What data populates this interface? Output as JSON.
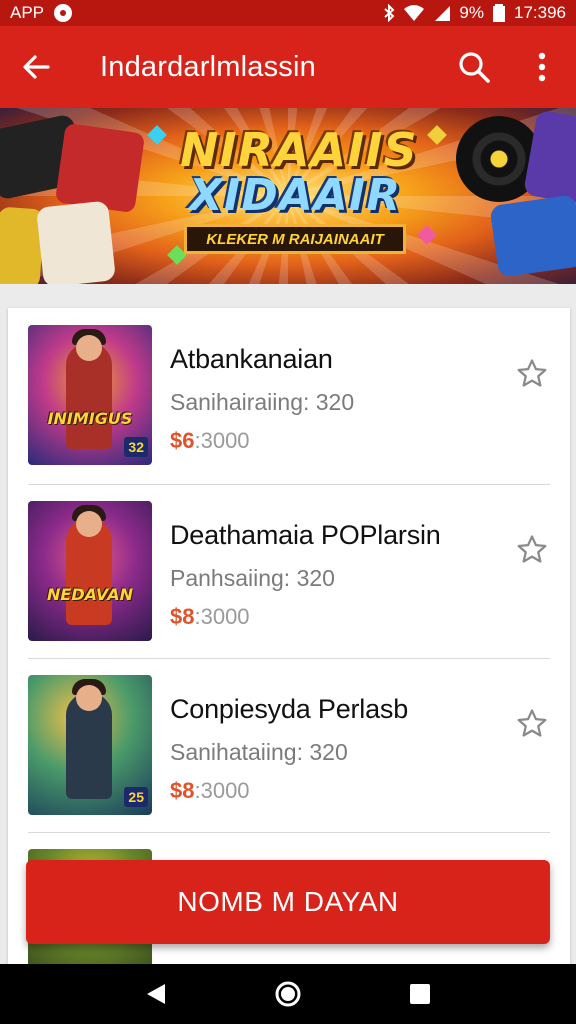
{
  "status_bar": {
    "app_label": "APP",
    "battery": "9%",
    "time": "17:396"
  },
  "app_bar": {
    "title": "Indardarlmlassin",
    "back_icon": "arrow-left-icon",
    "search_icon": "search-icon",
    "menu_icon": "more-vert-icon"
  },
  "banner": {
    "logo_line1": "NIRAAIIS",
    "logo_line2": "XIDAAIR",
    "ribbon": "KLEKER M RAIJAINAAIT"
  },
  "items": [
    {
      "name": "Atbankanaian",
      "subtitle": "Sanihairaiing: 320",
      "price_currency": "$6",
      "price_rest": ":3000",
      "thumb_label": "INIMIGUS",
      "thumb_num": "32",
      "favorite": false
    },
    {
      "name": "Deathamaia POPlarsin",
      "subtitle": "Panhsaiing: 320",
      "price_currency": "$8",
      "price_rest": ":3000",
      "thumb_label": "NEDAVAN",
      "thumb_num": "",
      "favorite": false
    },
    {
      "name": "Conpiesyda Perlasb",
      "subtitle": "Sanihataiing: 320",
      "price_currency": "$8",
      "price_rest": ":3000",
      "thumb_label": "",
      "thumb_num": "25",
      "favorite": false
    }
  ],
  "cta_button": {
    "label": "NOMB M DAYAN"
  },
  "nav_bar": {
    "back_icon": "triangle-back-icon",
    "home_icon": "circle-home-icon",
    "recents_icon": "square-recents-icon"
  },
  "colors": {
    "primary": "#d8231a",
    "status_bar": "#b8170f",
    "price_accent": "#e0522a"
  }
}
